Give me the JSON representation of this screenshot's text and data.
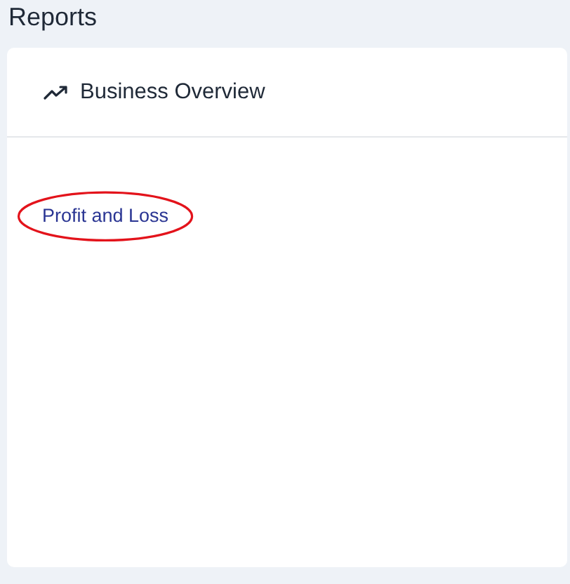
{
  "page": {
    "title": "Reports"
  },
  "card": {
    "title": "Business Overview",
    "links": [
      {
        "label": "Profit and Loss",
        "circled": true
      }
    ]
  }
}
